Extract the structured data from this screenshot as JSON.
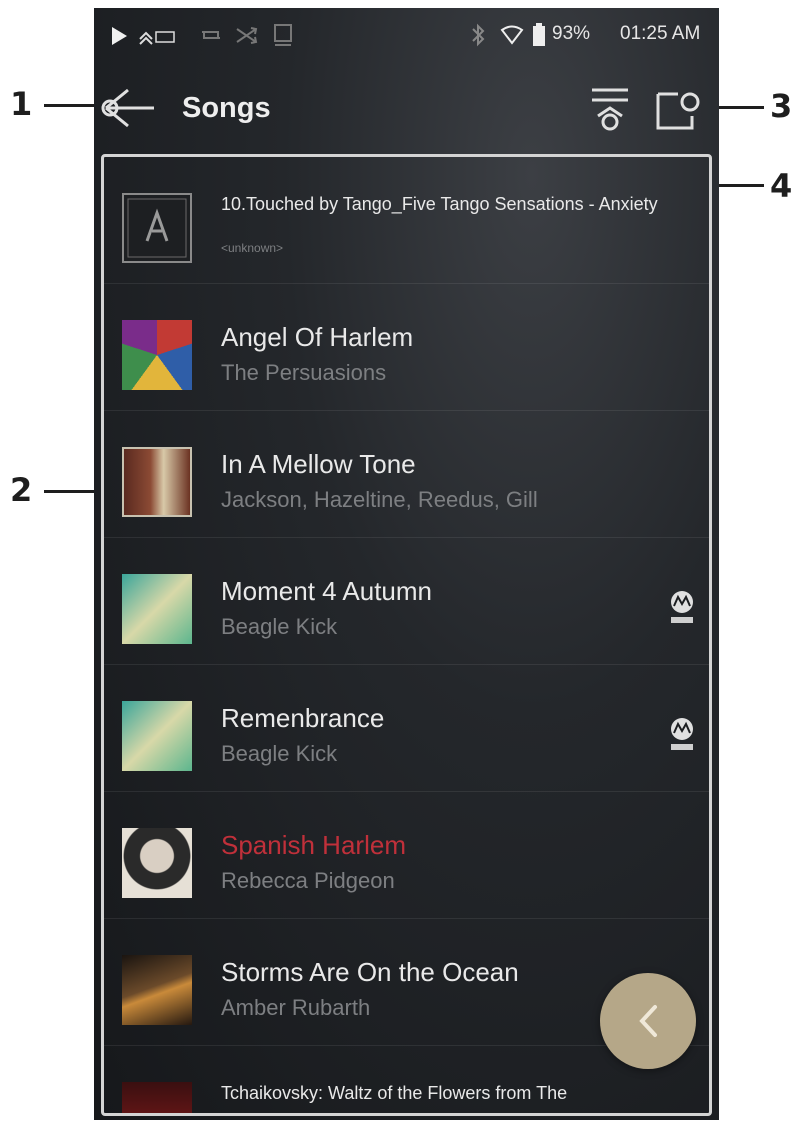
{
  "status_bar": {
    "battery_pct": "93%",
    "time": "01:25 AM",
    "icons": [
      "play-icon",
      "dsd-icon",
      "repeat-icon",
      "shuffle-icon",
      "gapless-icon",
      "bluetooth-icon",
      "wifi-icon",
      "battery-icon"
    ]
  },
  "app_bar": {
    "title": "Songs",
    "back_icon": "back-arrow-icon",
    "sort_icon": "sort-icon",
    "select_icon": "select-mode-icon"
  },
  "callouts": [
    "1",
    "2",
    "3",
    "4"
  ],
  "songs": [
    {
      "title": "10.Touched by Tango_Five Tango Sensations - Anxiety",
      "artist": "<unknown>",
      "art": "default-logo"
    },
    {
      "title": "Angel Of Harlem",
      "artist": "The Persuasions",
      "art": "album-art"
    },
    {
      "title": "In A Mellow Tone",
      "artist": "Jackson, Hazeltine, Reedus, Gill",
      "art": "album-art"
    },
    {
      "title": "Moment 4 Autumn",
      "artist": "Beagle Kick",
      "art": "album-art",
      "badge": "MQA"
    },
    {
      "title": "Remenbrance",
      "artist": "Beagle Kick",
      "art": "album-art",
      "badge": "MQA"
    },
    {
      "title": "Spanish Harlem",
      "artist": "Rebecca Pidgeon",
      "art": "album-art",
      "playing": true
    },
    {
      "title": "Storms Are On the Ocean",
      "artist": "Amber Rubarth",
      "art": "album-art"
    },
    {
      "title": "Tchaikovsky: Waltz of the Flowers from The",
      "artist": "",
      "art": "album-art"
    }
  ],
  "colors": {
    "now_playing": "#c0303a",
    "fab": "#b5a788"
  }
}
